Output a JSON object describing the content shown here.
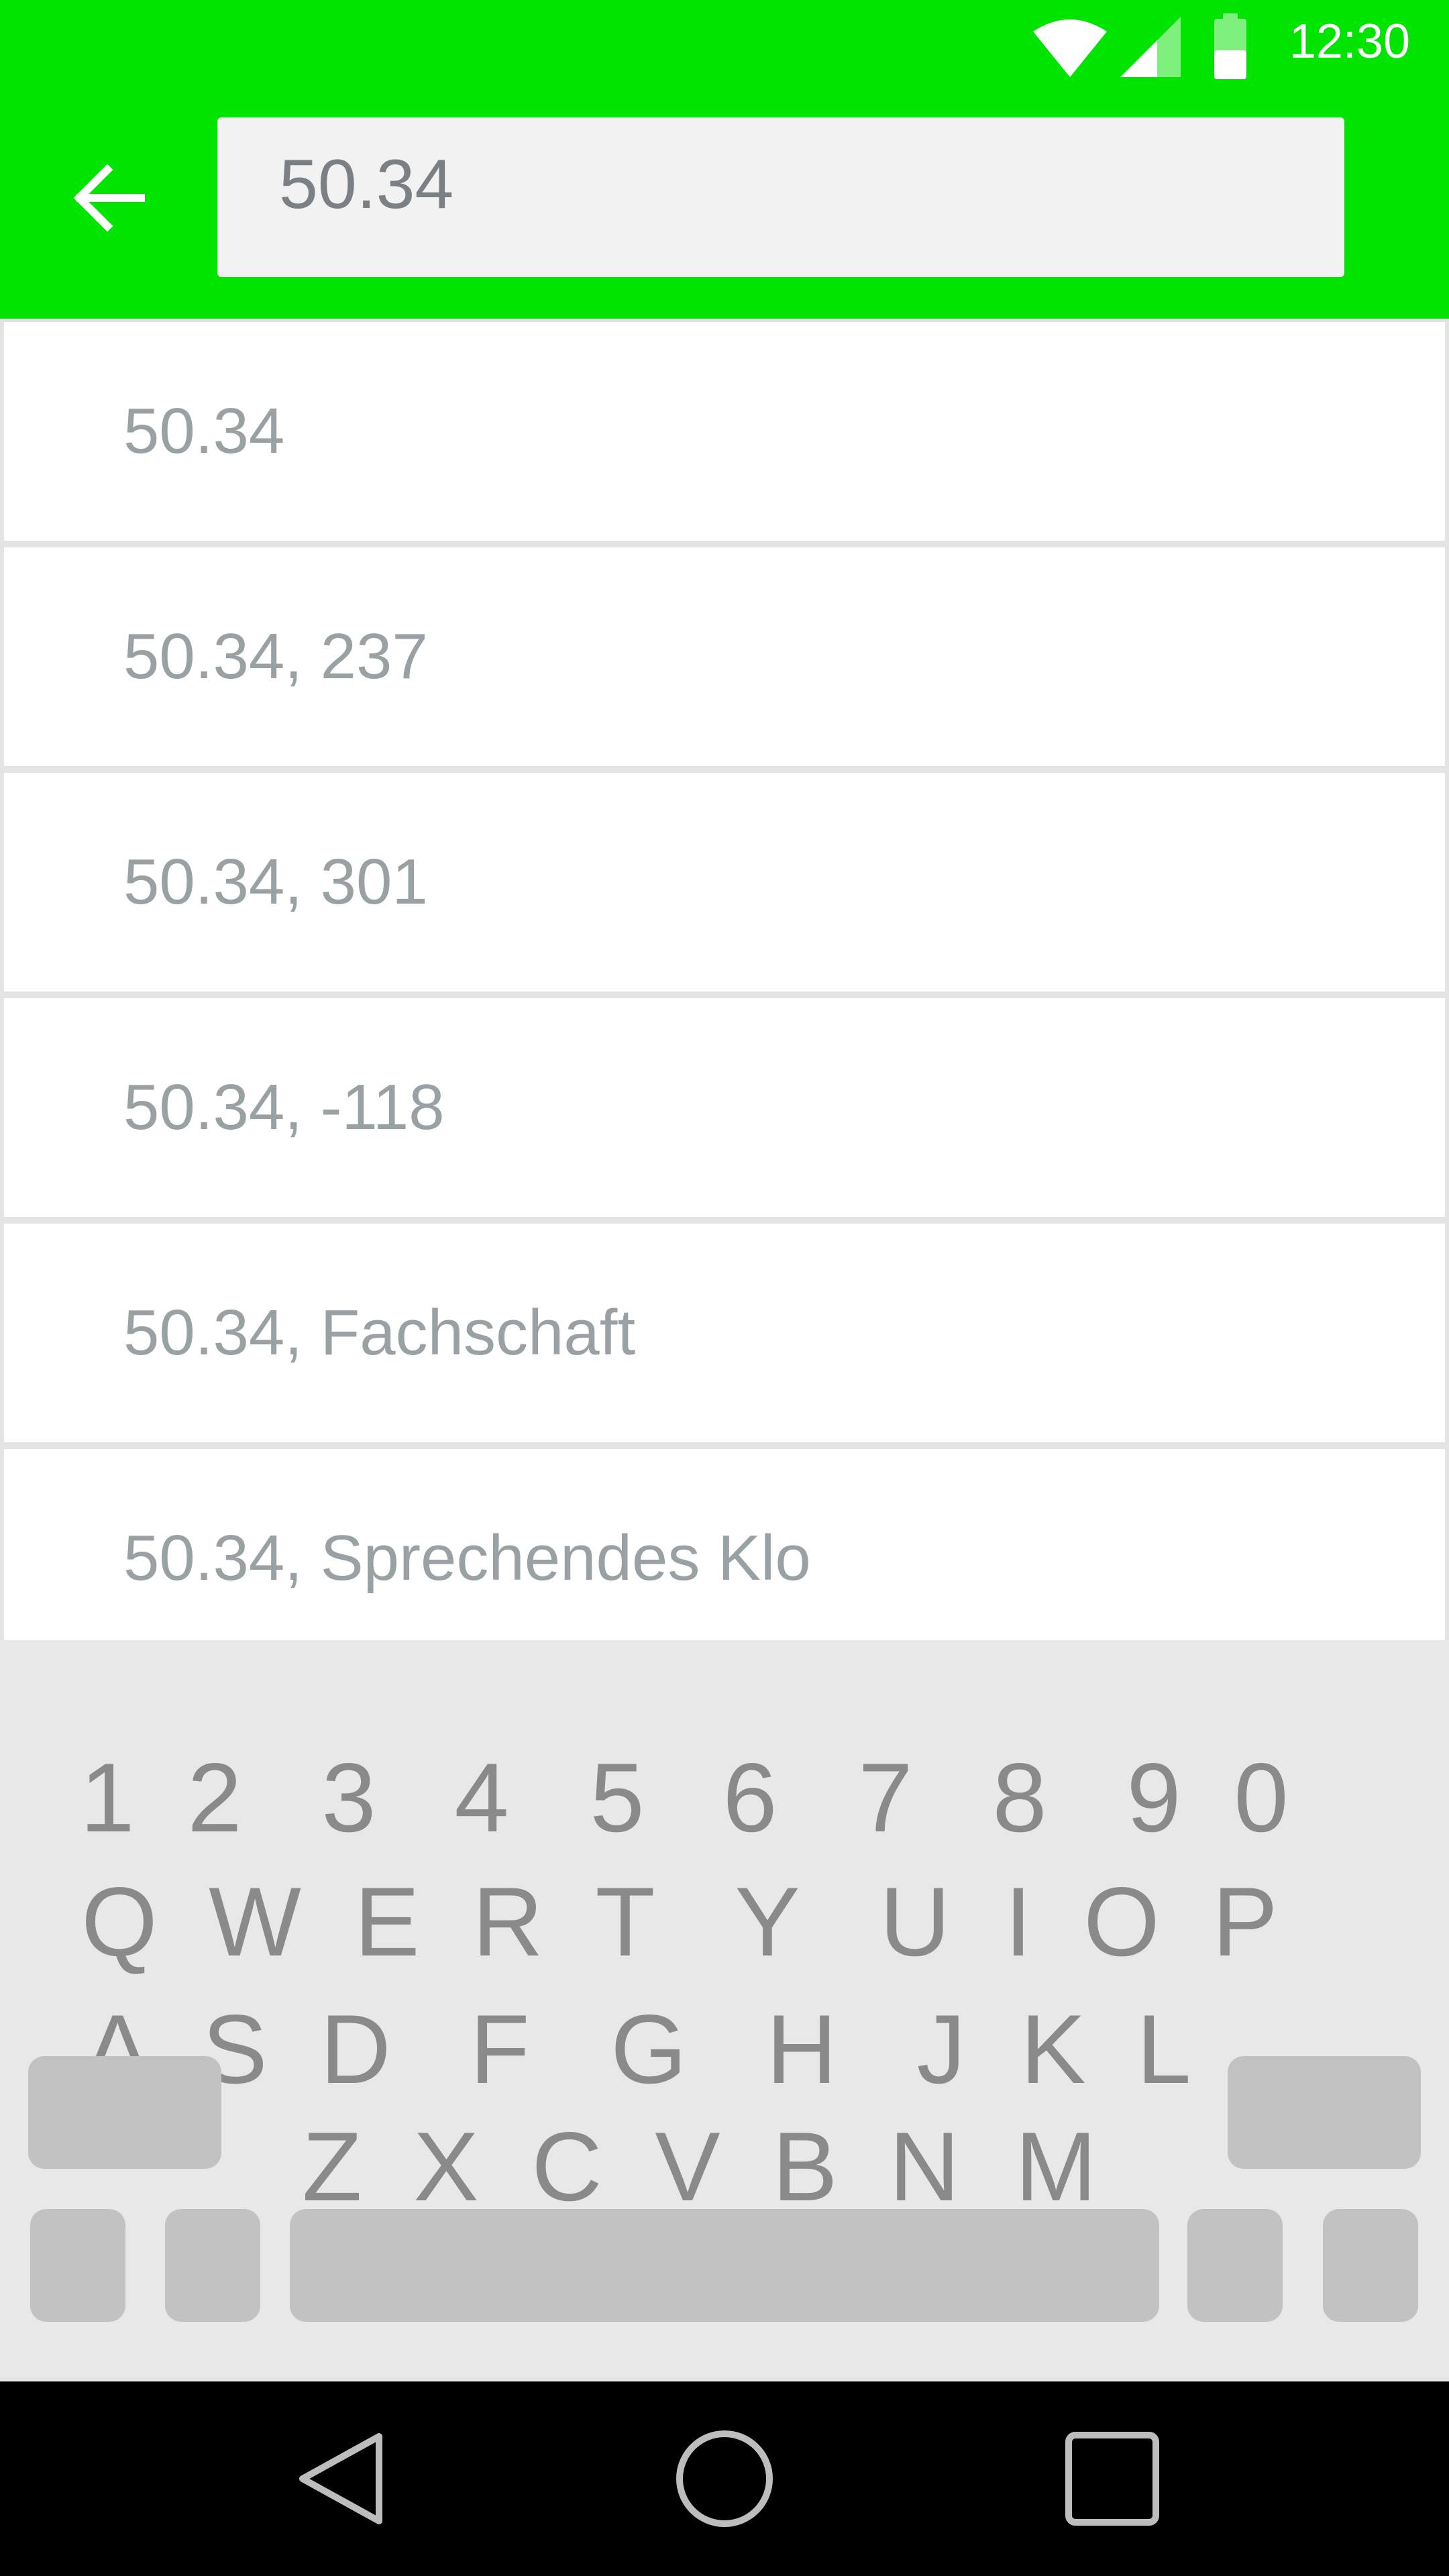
{
  "status_bar": {
    "time": "12:30"
  },
  "search": {
    "value": "50.34"
  },
  "results": [
    {
      "label": "50.34"
    },
    {
      "label": "50.34, 237"
    },
    {
      "label": "50.34, 301"
    },
    {
      "label": "50.34, -118"
    },
    {
      "label": "50.34, Fachschaft"
    },
    {
      "label": "50.34, Sprechendes Klo"
    }
  ],
  "keyboard": {
    "row1": [
      "1",
      "2",
      "3",
      "4",
      "5",
      "6",
      "7",
      "8",
      "9",
      "0"
    ],
    "row2": [
      "Q",
      "W",
      "E",
      "R",
      "T",
      "Y",
      "U",
      "I",
      "O",
      "P"
    ],
    "row3": [
      "A",
      "S",
      "D",
      "F",
      "G",
      "H",
      "J",
      "K",
      "L"
    ],
    "row4": [
      "Z",
      "X",
      "C",
      "V",
      "B",
      "N",
      "M"
    ]
  },
  "colors": {
    "accent": "#00e400",
    "keyboard_bg": "#e8e8e8",
    "key_text": "#8a8a8a",
    "list_text": "#9aa1a5"
  },
  "icons": {
    "back": "arrow-left-icon",
    "wifi": "wifi-icon",
    "signal": "signal-icon",
    "battery": "battery-icon",
    "nav_back": "triangle-back-icon",
    "nav_home": "circle-home-icon",
    "nav_recents": "square-recents-icon"
  }
}
